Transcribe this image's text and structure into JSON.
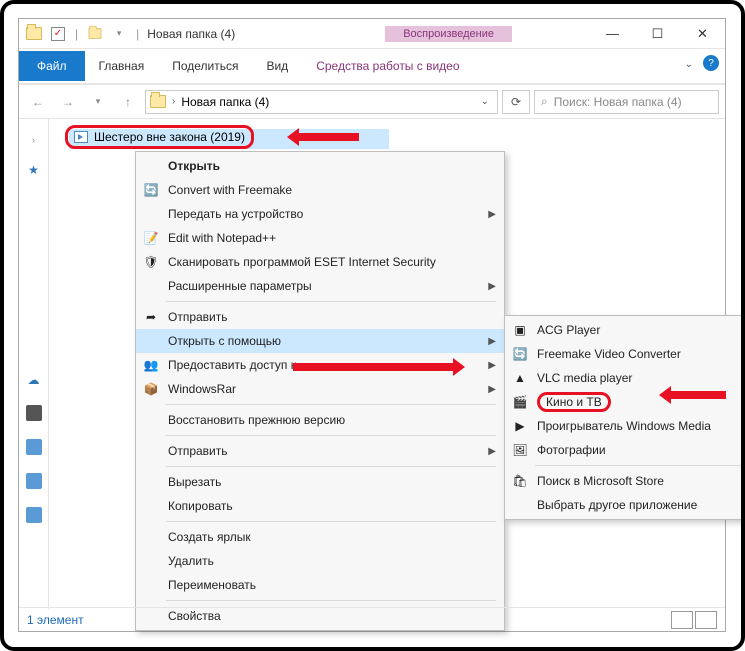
{
  "window": {
    "title": "Новая папка (4)",
    "contextual_tab_label": "Воспроизведение",
    "contextual_tab_name": "Средства работы с видео"
  },
  "ribbon": {
    "file": "Файл",
    "tabs": [
      "Главная",
      "Поделиться",
      "Вид"
    ]
  },
  "nav": {
    "breadcrumb": "Новая папка (4)",
    "search_placeholder": "Поиск: Новая папка (4)"
  },
  "file": {
    "name": "Шестеро вне закона (2019)"
  },
  "context_menu": [
    {
      "label": "Открыть",
      "bold": true
    },
    {
      "label": "Convert with Freemake",
      "icon": "🔄"
    },
    {
      "label": "Передать на устройство",
      "arrow": true
    },
    {
      "label": "Edit with Notepad++",
      "icon": "📝"
    },
    {
      "label": "Сканировать программой ESET Internet Security",
      "icon": "🛡"
    },
    {
      "label": "Расширенные параметры",
      "arrow": true
    },
    {
      "sep": true
    },
    {
      "label": "Отправить",
      "icon": "➦"
    },
    {
      "label": "Открыть с помощью",
      "arrow": true,
      "hl": true
    },
    {
      "label": "Предоставить доступ к",
      "icon": "👥",
      "arrow": true
    },
    {
      "label": "WindowsRar",
      "icon": "📦",
      "arrow": true
    },
    {
      "sep": true
    },
    {
      "label": "Восстановить прежнюю версию"
    },
    {
      "sep": true
    },
    {
      "label": "Отправить",
      "arrow": true
    },
    {
      "sep": true
    },
    {
      "label": "Вырезать"
    },
    {
      "label": "Копировать"
    },
    {
      "sep": true
    },
    {
      "label": "Создать ярлык"
    },
    {
      "label": "Удалить"
    },
    {
      "label": "Переименовать"
    },
    {
      "sep": true
    },
    {
      "label": "Свойства"
    }
  ],
  "submenu": {
    "items": [
      {
        "label": "ACG Player",
        "icon": "▣"
      },
      {
        "label": "Freemake Video Converter",
        "icon": "🔄"
      },
      {
        "label": "VLC media player",
        "icon": "▲"
      },
      {
        "label": "Кино и ТВ",
        "icon": "🎬",
        "hl": true
      },
      {
        "label": "Проигрыватель Windows Media",
        "icon": "▶"
      },
      {
        "label": "Фотографии",
        "icon": "🖼"
      }
    ],
    "store": "Поиск в Microsoft Store",
    "choose": "Выбрать другое приложение"
  },
  "status": {
    "count": "1 элемент"
  }
}
